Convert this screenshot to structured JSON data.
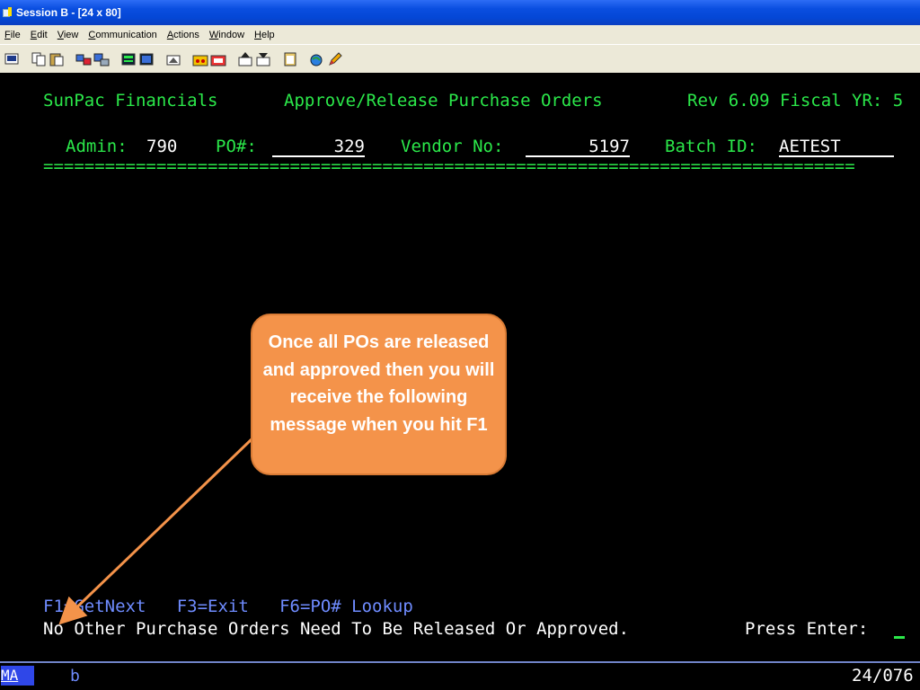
{
  "window": {
    "title": "Session B - [24 x 80]"
  },
  "menu": {
    "items": [
      {
        "u": "F",
        "rest": "ile"
      },
      {
        "u": "E",
        "rest": "dit"
      },
      {
        "u": "V",
        "rest": "iew"
      },
      {
        "u": "C",
        "rest": "ommunication"
      },
      {
        "u": "A",
        "rest": "ctions"
      },
      {
        "u": "W",
        "rest": "indow"
      },
      {
        "u": "H",
        "rest": "elp"
      }
    ]
  },
  "terminal": {
    "header": {
      "company": "SunPac Financials",
      "screen_title": "Approve/Release Purchase Orders",
      "rev": "Rev 6.09 Fiscal YR: 5"
    },
    "fields": {
      "admin_label": "Admin:",
      "admin_value": "790",
      "po_label": "PO#:",
      "po_value": "329",
      "vendor_label": "Vendor No:",
      "vendor_value": "5197",
      "batch_label": "Batch ID:",
      "batch_value": "AETEST"
    },
    "separator": "===============================================================================",
    "function_keys": "F1=GetNext   F3=Exit   F6=PO# Lookup",
    "message": "No Other Purchase Orders Need To Be Released Or Approved.",
    "prompt": "Press Enter:"
  },
  "callout": {
    "text": "Once all POs are released and approved then you will receive the following message when you hit F1",
    "color": "#f4934a"
  },
  "status": {
    "mode": "MA",
    "session": "b",
    "cursor_pos": "24/076"
  }
}
